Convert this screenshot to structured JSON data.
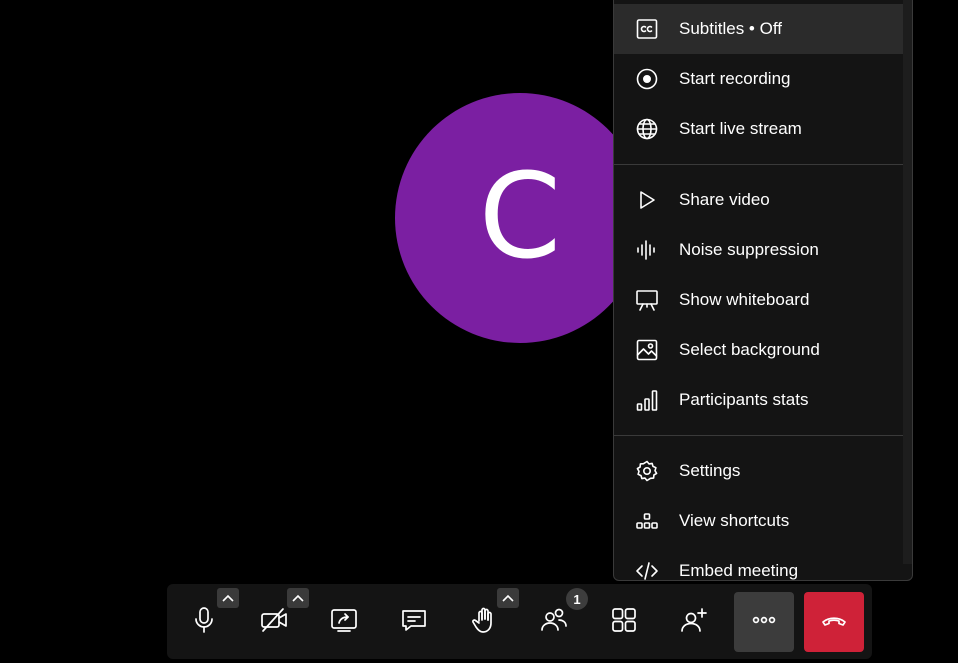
{
  "avatar": {
    "initial": "C",
    "color": "#7b1fa2"
  },
  "menu": {
    "items": [
      {
        "label": "Subtitles • Off",
        "icon": "closed-captions-icon",
        "active": true
      },
      {
        "label": "Start recording",
        "icon": "record-icon"
      },
      {
        "label": "Start live stream",
        "icon": "globe-icon"
      },
      {
        "label": "Share video",
        "icon": "play-icon"
      },
      {
        "label": "Noise suppression",
        "icon": "waveform-icon"
      },
      {
        "label": "Show whiteboard",
        "icon": "whiteboard-icon"
      },
      {
        "label": "Select background",
        "icon": "image-icon"
      },
      {
        "label": "Participants stats",
        "icon": "bar-chart-icon"
      },
      {
        "label": "Settings",
        "icon": "gear-icon"
      },
      {
        "label": "View shortcuts",
        "icon": "shortcuts-icon"
      },
      {
        "label": "Embed meeting",
        "icon": "code-icon"
      }
    ]
  },
  "toolbar": {
    "buttons": [
      {
        "name": "microphone",
        "icon": "microphone-icon"
      },
      {
        "name": "camera",
        "icon": "camera-off-icon"
      },
      {
        "name": "share-screen",
        "icon": "screen-share-icon"
      },
      {
        "name": "chat",
        "icon": "chat-icon"
      },
      {
        "name": "raise-hand",
        "icon": "hand-icon"
      },
      {
        "name": "participants",
        "icon": "participants-icon"
      },
      {
        "name": "tile-view",
        "icon": "grid-icon"
      },
      {
        "name": "invite",
        "icon": "add-person-icon"
      },
      {
        "name": "more",
        "icon": "more-dots-icon"
      },
      {
        "name": "hangup",
        "icon": "hangup-icon"
      }
    ],
    "participant_count": "1",
    "hangup_color": "#cf2238"
  }
}
